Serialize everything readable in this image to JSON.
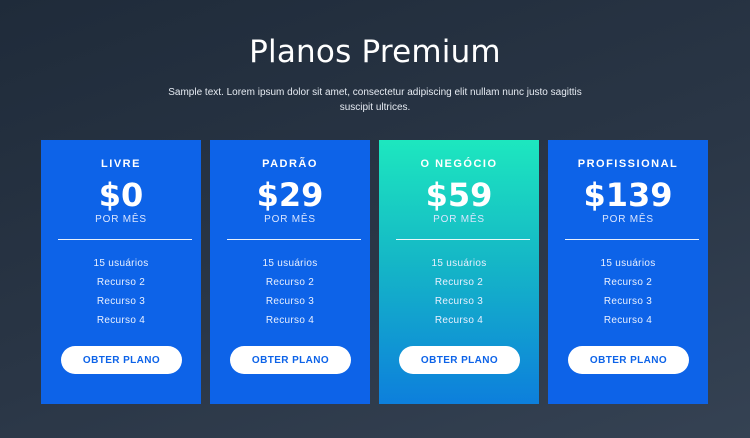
{
  "header": {
    "title": "Planos Premium",
    "subtitle": "Sample text. Lorem ipsum dolor sit amet, consectetur adipiscing elit nullam nunc justo sagittis suscipit ultrices."
  },
  "colors": {
    "card_blue": "#0d63e8",
    "featured_gradient_top": "#1de7bf",
    "featured_gradient_bottom": "#0d7fdc",
    "background": "#2a3646"
  },
  "plans": [
    {
      "name": "LIVRE",
      "price": "$0",
      "period": "POR MÊS",
      "features": [
        "15 usuários",
        "Recurso 2",
        "Recurso 3",
        "Recurso 4"
      ],
      "cta_label": "OBTER PLANO"
    },
    {
      "name": "PADRÃO",
      "price": "$29",
      "period": "POR MÊS",
      "features": [
        "15 usuários",
        "Recurso 2",
        "Recurso 3",
        "Recurso 4"
      ],
      "cta_label": "OBTER PLANO"
    },
    {
      "name": "O NEGÓCIO",
      "price": "$59",
      "period": "POR MÊS",
      "features": [
        "15 usuários",
        "Recurso 2",
        "Recurso 3",
        "Recurso 4"
      ],
      "cta_label": "OBTER PLANO"
    },
    {
      "name": "PROFISSIONAL",
      "price": "$139",
      "period": "POR MÊS",
      "features": [
        "15 usuários",
        "Recurso 2",
        "Recurso 3",
        "Recurso 4"
      ],
      "cta_label": "OBTER PLANO"
    }
  ]
}
